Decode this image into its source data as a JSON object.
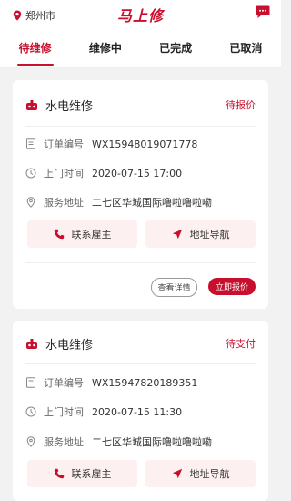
{
  "header": {
    "city": "郑州市",
    "brand": "马上修"
  },
  "tabs": [
    {
      "label": "待维修",
      "active": true
    },
    {
      "label": "维修中",
      "active": false
    },
    {
      "label": "已完成",
      "active": false
    },
    {
      "label": "已取消",
      "active": false
    }
  ],
  "orders": [
    {
      "title": "水电维修",
      "status": "待报价",
      "order_label": "订单编号",
      "order_no": "WX15948019071778",
      "time_label": "上门时间",
      "time": "2020-07-15 17:00",
      "addr_label": "服务地址",
      "address": "二七区华城国际噜啦噜啦嘞",
      "contact_btn": "联系雇主",
      "nav_btn": "地址导航",
      "detail_btn": "查看详情",
      "action_btn": "立即报价"
    },
    {
      "title": "水电维修",
      "status": "待支付",
      "order_label": "订单编号",
      "order_no": "WX15947820189351",
      "time_label": "上门时间",
      "time": "2020-07-15 11:30",
      "addr_label": "服务地址",
      "address": "二七区华城国际噜啦噜啦嘞",
      "contact_btn": "联系雇主",
      "nav_btn": "地址导航"
    }
  ],
  "colors": {
    "accent": "#c8102e",
    "button_bg": "#fdf0f0",
    "page_bg": "#f2f2f2"
  },
  "icons": {
    "location": "location-pin-icon",
    "message": "message-icon",
    "service": "repair-bot-icon",
    "order": "document-icon",
    "time": "clock-icon",
    "address": "map-pin-icon",
    "phone": "phone-icon",
    "navigate": "navigation-arrow-icon"
  }
}
